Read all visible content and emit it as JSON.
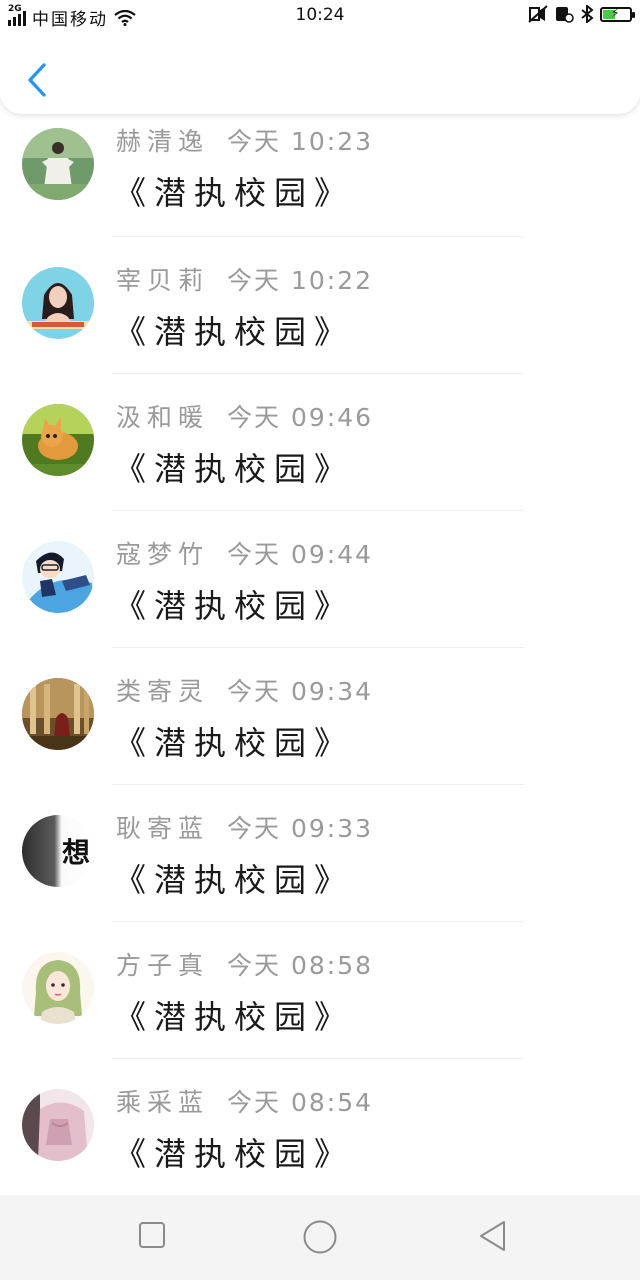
{
  "status_bar": {
    "network": "2G",
    "carrier": "中国移动",
    "time": "10:24",
    "battery_level": 0.45,
    "icons": [
      "signal-icon",
      "wifi-icon",
      "mute-icon",
      "sim-icon",
      "bluetooth-icon",
      "battery-icon"
    ]
  },
  "header": {
    "back_icon": "chevron-left-icon",
    "accent_color": "#2196f3"
  },
  "messages": [
    {
      "name": "赫清逸",
      "time": "今天 10:23",
      "content": "《潜执校园》",
      "avatar": "avatar-girl-in-forest"
    },
    {
      "name": "宰贝莉",
      "time": "今天 10:22",
      "content": "《潜执校园》",
      "avatar": "avatar-girl-portrait"
    },
    {
      "name": "汲和暖",
      "time": "今天 09:46",
      "content": "《潜执校园》",
      "avatar": "avatar-kitten"
    },
    {
      "name": "寇梦竹",
      "time": "今天 09:44",
      "content": "《潜执校园》",
      "avatar": "avatar-anime-boy"
    },
    {
      "name": "类寄灵",
      "time": "今天 09:34",
      "content": "《潜执校园》",
      "avatar": "avatar-sepia-photo"
    },
    {
      "name": "耿寄蓝",
      "time": "今天 09:33",
      "content": "《潜执校园》",
      "avatar": "avatar-text-想",
      "avatar_text": "想"
    },
    {
      "name": "方子真",
      "time": "今天 08:58",
      "content": "《潜执校园》",
      "avatar": "avatar-drawn-girl"
    },
    {
      "name": "乘采蓝",
      "time": "今天 08:54",
      "content": "《潜执校园》",
      "avatar": "avatar-pink-doll"
    }
  ],
  "nav_bar": {
    "buttons": [
      "recent-apps-icon",
      "home-icon",
      "back-triangle-icon"
    ]
  }
}
